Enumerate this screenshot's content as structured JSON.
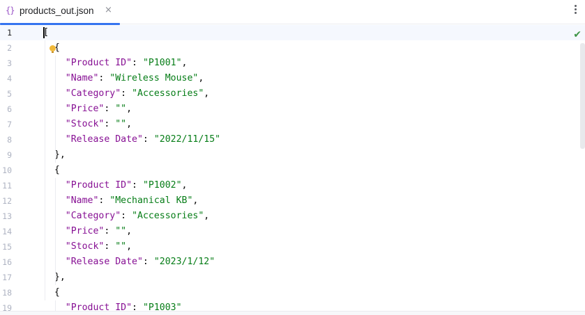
{
  "tab": {
    "icon_text": "{}",
    "title": "products_out.json",
    "close_glyph": "×",
    "accent_color": "#3574f0"
  },
  "editor": {
    "current_line": 1,
    "status_icon": "check-icon",
    "lines": [
      {
        "n": "1",
        "tokens": [
          [
            "p",
            "["
          ]
        ]
      },
      {
        "n": "2",
        "tokens": [
          [
            "p",
            "  {"
          ]
        ]
      },
      {
        "n": "3",
        "tokens": [
          [
            "p",
            "    "
          ],
          [
            "k",
            "\"Product ID\""
          ],
          [
            "p",
            ": "
          ],
          [
            "s",
            "\"P1001\""
          ],
          [
            "p",
            ","
          ]
        ]
      },
      {
        "n": "4",
        "tokens": [
          [
            "p",
            "    "
          ],
          [
            "k",
            "\"Name\""
          ],
          [
            "p",
            ": "
          ],
          [
            "s",
            "\"Wireless Mouse\""
          ],
          [
            "p",
            ","
          ]
        ]
      },
      {
        "n": "5",
        "tokens": [
          [
            "p",
            "    "
          ],
          [
            "k",
            "\"Category\""
          ],
          [
            "p",
            ": "
          ],
          [
            "s",
            "\"Accessories\""
          ],
          [
            "p",
            ","
          ]
        ]
      },
      {
        "n": "6",
        "tokens": [
          [
            "p",
            "    "
          ],
          [
            "k",
            "\"Price\""
          ],
          [
            "p",
            ": "
          ],
          [
            "s",
            "\"\""
          ],
          [
            "p",
            ","
          ]
        ]
      },
      {
        "n": "7",
        "tokens": [
          [
            "p",
            "    "
          ],
          [
            "k",
            "\"Stock\""
          ],
          [
            "p",
            ": "
          ],
          [
            "s",
            "\"\""
          ],
          [
            "p",
            ","
          ]
        ]
      },
      {
        "n": "8",
        "tokens": [
          [
            "p",
            "    "
          ],
          [
            "k",
            "\"Release Date\""
          ],
          [
            "p",
            ": "
          ],
          [
            "s",
            "\"2022/11/15\""
          ]
        ]
      },
      {
        "n": "9",
        "tokens": [
          [
            "p",
            "  },"
          ]
        ]
      },
      {
        "n": "10",
        "tokens": [
          [
            "p",
            "  {"
          ]
        ]
      },
      {
        "n": "11",
        "tokens": [
          [
            "p",
            "    "
          ],
          [
            "k",
            "\"Product ID\""
          ],
          [
            "p",
            ": "
          ],
          [
            "s",
            "\"P1002\""
          ],
          [
            "p",
            ","
          ]
        ]
      },
      {
        "n": "12",
        "tokens": [
          [
            "p",
            "    "
          ],
          [
            "k",
            "\"Name\""
          ],
          [
            "p",
            ": "
          ],
          [
            "s",
            "\"Mechanical KB\""
          ],
          [
            "p",
            ","
          ]
        ]
      },
      {
        "n": "13",
        "tokens": [
          [
            "p",
            "    "
          ],
          [
            "k",
            "\"Category\""
          ],
          [
            "p",
            ": "
          ],
          [
            "s",
            "\"Accessories\""
          ],
          [
            "p",
            ","
          ]
        ]
      },
      {
        "n": "14",
        "tokens": [
          [
            "p",
            "    "
          ],
          [
            "k",
            "\"Price\""
          ],
          [
            "p",
            ": "
          ],
          [
            "s",
            "\"\""
          ],
          [
            "p",
            ","
          ]
        ]
      },
      {
        "n": "15",
        "tokens": [
          [
            "p",
            "    "
          ],
          [
            "k",
            "\"Stock\""
          ],
          [
            "p",
            ": "
          ],
          [
            "s",
            "\"\""
          ],
          [
            "p",
            ","
          ]
        ]
      },
      {
        "n": "16",
        "tokens": [
          [
            "p",
            "    "
          ],
          [
            "k",
            "\"Release Date\""
          ],
          [
            "p",
            ": "
          ],
          [
            "s",
            "\"2023/1/12\""
          ]
        ]
      },
      {
        "n": "17",
        "tokens": [
          [
            "p",
            "  },"
          ]
        ]
      },
      {
        "n": "18",
        "tokens": [
          [
            "p",
            "  {"
          ]
        ]
      },
      {
        "n": "19",
        "tokens": [
          [
            "p",
            "    "
          ],
          [
            "k",
            "\"Product ID\""
          ],
          [
            "p",
            ": "
          ],
          [
            "s",
            "\"P1003\""
          ]
        ]
      }
    ]
  }
}
